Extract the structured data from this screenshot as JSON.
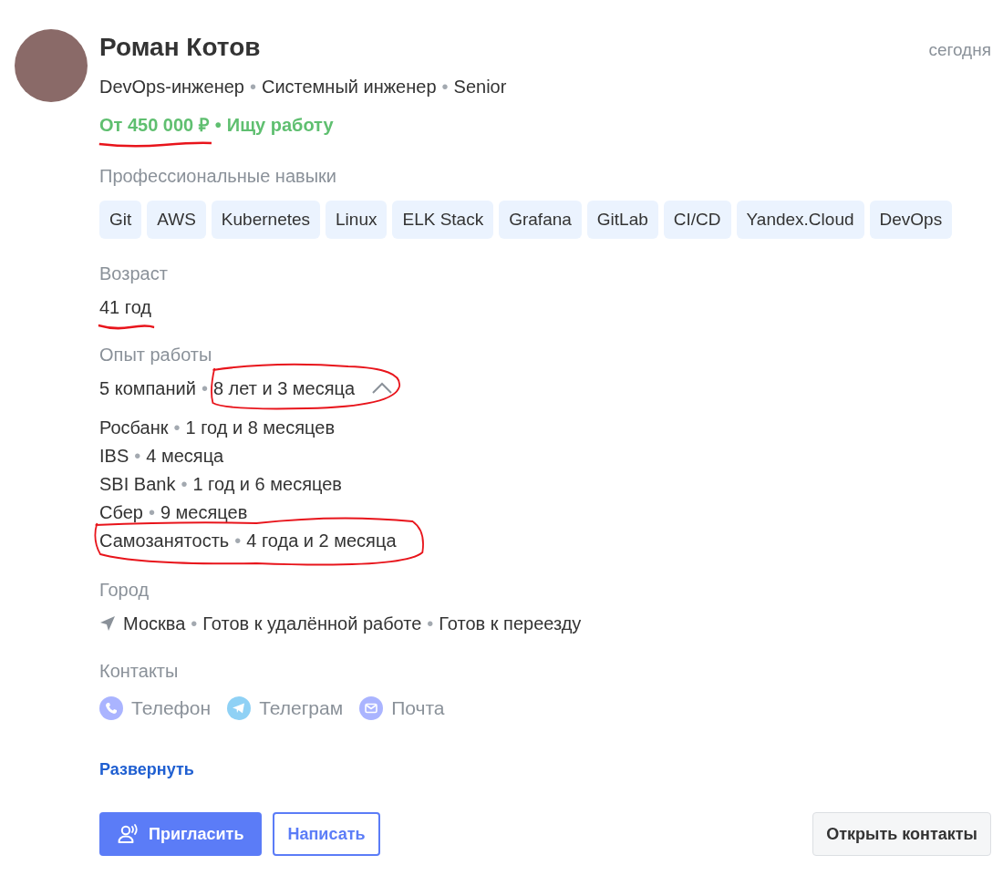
{
  "card": {
    "name": "Роман Котов",
    "date": "сегодня",
    "separator": "•",
    "positions": [
      "DevOps-инженер",
      "Системный инженер",
      "Senior"
    ],
    "salary": {
      "text": "От 450 000 ₽",
      "annotated": true
    },
    "job_status": "Ищу работу",
    "skills": {
      "label": "Профессиональные навыки",
      "items": [
        "Git",
        "AWS",
        "Kubernetes",
        "Linux",
        "ELK Stack",
        "Grafana",
        "GitLab",
        "CI/CD",
        "Yandex.Cloud",
        "DevOps"
      ]
    },
    "age": {
      "label": "Возраст",
      "value": "41 год",
      "annotated": true
    },
    "experience": {
      "label": "Опыт работы",
      "companies_count": "5 компаний",
      "total": "8 лет и 3 месяца",
      "expanded": true,
      "annotated": true,
      "companies": [
        {
          "name": "Росбанк",
          "duration": "1 год и 8 месяцев",
          "annotated": false
        },
        {
          "name": "IBS",
          "duration": "4 месяца",
          "annotated": false
        },
        {
          "name": "SBI Bank",
          "duration": "1 год и 6 месяцев",
          "annotated": false
        },
        {
          "name": "Сбер",
          "duration": "9 месяцев",
          "annotated": false
        },
        {
          "name": "Самозанятость",
          "duration": "4 года и 2 месяца",
          "annotated": true
        }
      ]
    },
    "city": {
      "label": "Город",
      "items": [
        "Москва",
        "Готов к удалённой работе",
        "Готов к переезду"
      ]
    },
    "contacts": {
      "label": "Контакты",
      "items": [
        {
          "kind": "phone",
          "label": "Телефон"
        },
        {
          "kind": "telegram",
          "label": "Телеграм"
        },
        {
          "kind": "email",
          "label": "Почта"
        }
      ]
    },
    "expand_link": "Развернуть",
    "buttons": [
      {
        "kind": "primary",
        "label": "Пригласить"
      },
      {
        "kind": "outline",
        "label": "Написать"
      },
      {
        "kind": "secondary",
        "label": "Открыть контакты"
      }
    ]
  }
}
